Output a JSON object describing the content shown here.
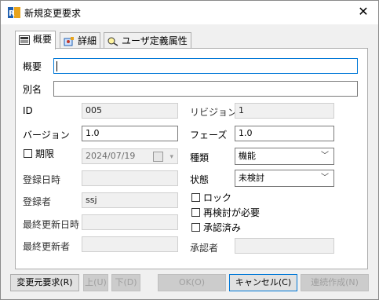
{
  "window": {
    "title": "新規変更要求",
    "close_glyph": "✕",
    "app_icon": "rd-logo-icon"
  },
  "tabs": [
    {
      "label": "概要",
      "icon": "summary-icon",
      "active": true
    },
    {
      "label": "詳細",
      "icon": "details-icon",
      "active": false
    },
    {
      "label": "ユーザ定義属性",
      "icon": "user-attributes-icon",
      "active": false
    }
  ],
  "form": {
    "summary": {
      "label": "概要",
      "value": ""
    },
    "alias": {
      "label": "別名",
      "value": ""
    },
    "id": {
      "label": "ID",
      "value": "005"
    },
    "revision": {
      "label": "リビジョン",
      "value": "1"
    },
    "version": {
      "label": "バージョン",
      "value": "1.0"
    },
    "phase": {
      "label": "フェーズ",
      "value": "1.0"
    },
    "deadline": {
      "label": "期限",
      "value": "2024/07/19",
      "checked": false
    },
    "type": {
      "label": "種類",
      "value": "機能"
    },
    "registered_date": {
      "label": "登録日時",
      "value": ""
    },
    "status": {
      "label": "状態",
      "value": "未検討"
    },
    "registrant": {
      "label": "登録者",
      "value": "ssj"
    },
    "lock": {
      "label": "ロック",
      "checked": false
    },
    "recheck": {
      "label": "再検討が必要",
      "checked": false
    },
    "approved": {
      "label": "承認済み",
      "checked": false
    },
    "last_updated": {
      "label": "最終更新日時",
      "value": ""
    },
    "last_updater": {
      "label": "最終更新者",
      "value": ""
    },
    "approver": {
      "label": "承認者",
      "value": ""
    }
  },
  "buttons": {
    "source_request": "変更元要求(R)",
    "up": "上(U)",
    "down": "下(D)",
    "ok": "OK(O)",
    "cancel": "キャンセル(C)",
    "continuous_create": "連続作成(N)"
  }
}
